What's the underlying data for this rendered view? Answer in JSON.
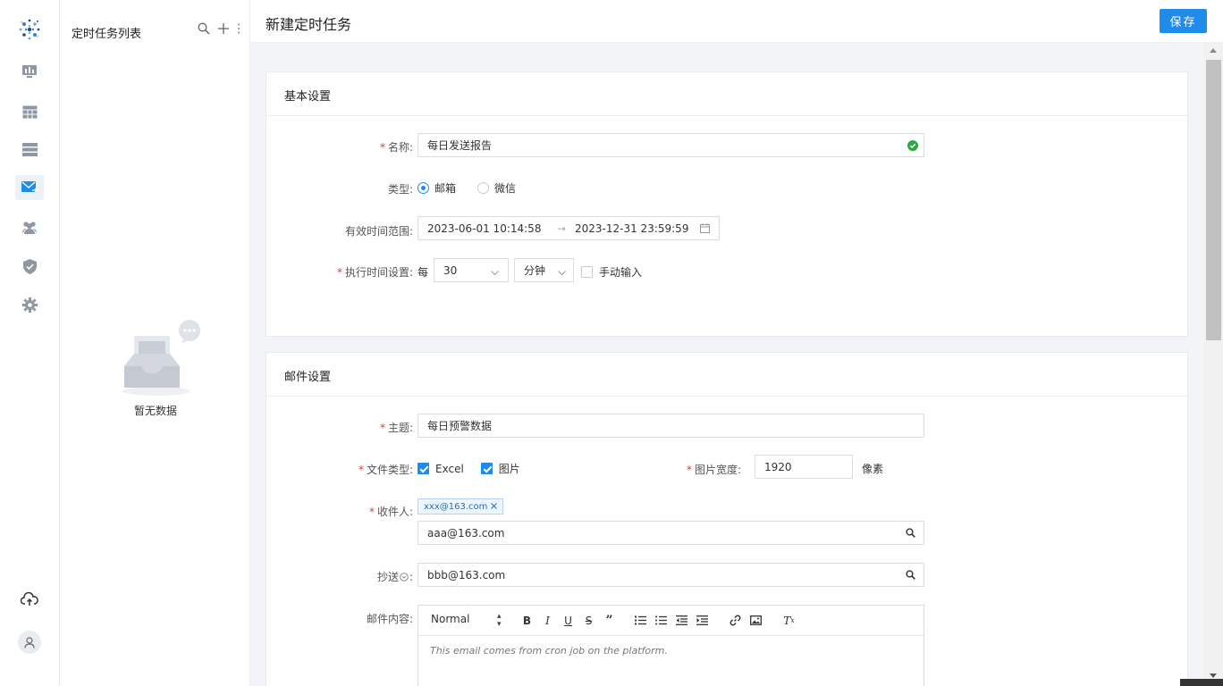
{
  "header": {
    "title": "新建定时任务",
    "save_label": "保存"
  },
  "task_list": {
    "title": "定时任务列表",
    "empty_text": "暂无数据"
  },
  "basic": {
    "section_title": "基本设置",
    "name_label": "名称:",
    "name_value": "每日发送报告",
    "type_label": "类型:",
    "type_options": [
      "邮箱",
      "微信"
    ],
    "range_label": "有效时间范围:",
    "range_start": "2023-06-01 10:14:58",
    "range_end": "2023-12-31 23:59:59",
    "range_sep": "→",
    "exec_label": "执行时间设置:",
    "exec_prefix": "每",
    "exec_value": "30",
    "exec_unit": "分钟",
    "manual_label": "手动输入"
  },
  "mail": {
    "section_title": "邮件设置",
    "subject_label": "主题:",
    "subject_value": "每日预警数据",
    "filetype_label": "文件类型:",
    "filetype_options": [
      "Excel",
      "图片"
    ],
    "imgwidth_label": "图片宽度:",
    "imgwidth_value": "1920",
    "imgwidth_unit": "像素",
    "recipients_label": "收件人:",
    "recipient_tag": "xxx@163.com",
    "recipient_input": "aaa@163.com",
    "cc_label": "抄送",
    "cc_input": "bbb@163.com",
    "content_label": "邮件内容:",
    "format_select": "Normal",
    "content_text": "This email comes from cron job on the platform."
  },
  "colors": {
    "accent": "#1f8ceb",
    "required": "#e2363a",
    "success": "#2aa845"
  }
}
